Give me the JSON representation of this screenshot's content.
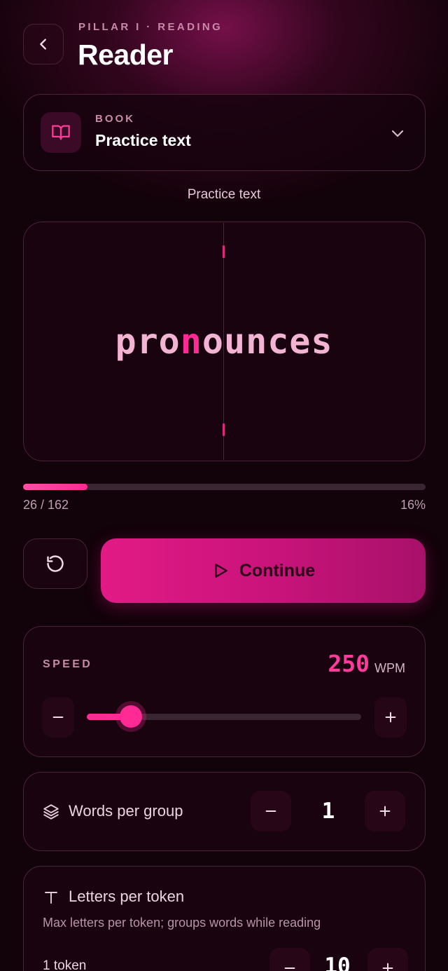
{
  "header": {
    "eyebrow": "PILLAR I · READING",
    "title": "Reader",
    "back_icon": "chevron-left-icon"
  },
  "book": {
    "eyebrow": "BOOK",
    "name": "Practice text",
    "icon": "book-open-icon",
    "dropdown_icon": "chevron-down-icon"
  },
  "reader": {
    "text_title": "Practice text",
    "word_before": "pro",
    "word_focus": "n",
    "word_after": "ounces"
  },
  "progress": {
    "count": "26 / 162",
    "percent_label": "16%",
    "fraction": 0.16
  },
  "controls": {
    "restart_icon": "restart-icon",
    "continue_label": "Continue",
    "play_icon": "play-icon"
  },
  "speed": {
    "label": "SPEED",
    "value": "250",
    "unit": "WPM",
    "slider_fraction": 0.16
  },
  "group": {
    "label": "Words per group",
    "value": "1",
    "icon": "layers-icon"
  },
  "token": {
    "label": "Letters per token",
    "description": "Max letters per token; groups words while reading",
    "sub_label": "1 token",
    "value": "10",
    "icon": "text-icon"
  },
  "colors": {
    "accent": "#ff2a93",
    "background": "#120209",
    "card": "#18030f"
  }
}
